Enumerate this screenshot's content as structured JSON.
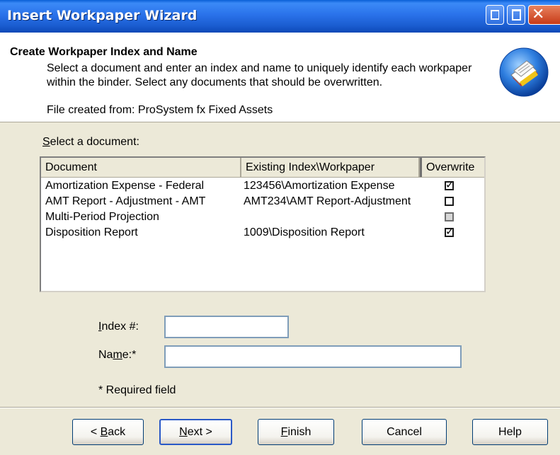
{
  "window": {
    "title": "Insert Workpaper Wizard"
  },
  "header": {
    "title": "Create Workpaper Index and Name",
    "description": "Select a document and enter an index and name to uniquely identify each workpaper within the binder. Select any documents that should be overwritten.",
    "source": "File created from: ProSystem fx Fixed Assets"
  },
  "list": {
    "label_mnemonic": "S",
    "label_rest": "elect a document:",
    "columns": [
      "Document",
      "Existing Index\\Workpaper",
      "Overwrite"
    ],
    "rows": [
      {
        "document": "Amortization Expense - Federal",
        "existing": "123456\\Amortization Expense",
        "overwrite": "checked"
      },
      {
        "document": "AMT Report - Adjustment - AMT",
        "existing": "AMT234\\AMT Report-Adjustment",
        "overwrite": "unchecked"
      },
      {
        "document": "Multi-Period Projection",
        "existing": "",
        "overwrite": "disabled"
      },
      {
        "document": "Disposition Report",
        "existing": "1009\\Disposition Report",
        "overwrite": "checked"
      }
    ]
  },
  "form": {
    "index_label_mnemonic": "I",
    "index_label_rest": "ndex #:",
    "index_value": "",
    "name_label_pre": "Na",
    "name_label_mnemonic": "m",
    "name_label_rest": "e:*",
    "name_value": "",
    "required_note": "* Required field"
  },
  "buttons": {
    "back_pre": "< ",
    "back_mnemonic": "B",
    "back_rest": "ack",
    "next_mnemonic": "N",
    "next_rest": "ext >",
    "finish_mnemonic": "F",
    "finish_rest": "inish",
    "cancel": "Cancel",
    "help": "Help"
  },
  "colors": {
    "titlebar": "#2a72ea",
    "dialog_bg": "#ece9d8",
    "default_button_border": "#2a59c7"
  },
  "icons": {
    "header": "documents-wizard-icon",
    "checked": "checkmark-icon"
  }
}
